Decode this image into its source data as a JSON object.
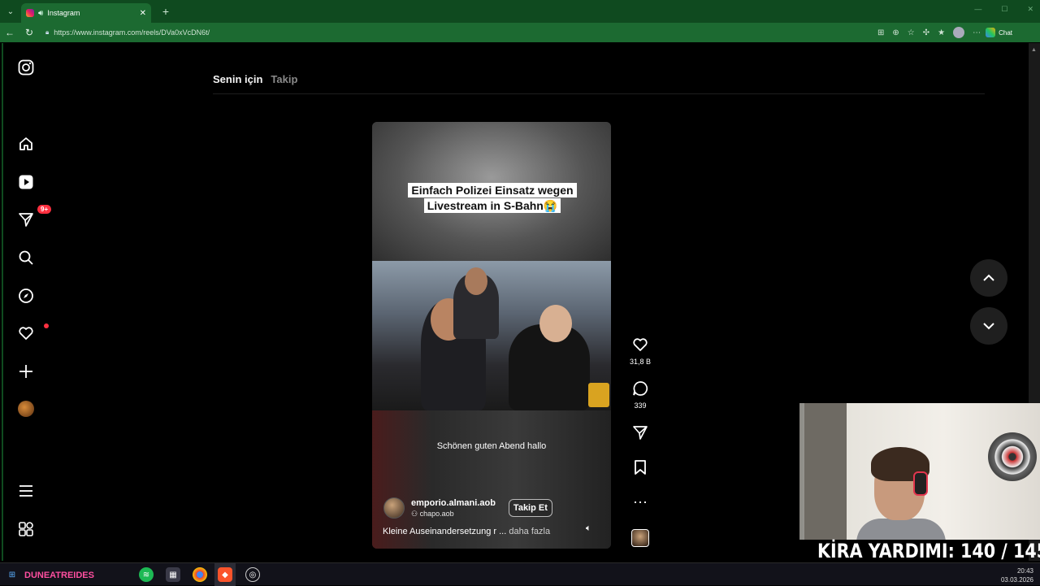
{
  "browser": {
    "tab_title": "Instagram",
    "url": "https://www.instagram.com/reels/DVa0xVcDN6t/",
    "chat_label": "Chat"
  },
  "sidebar": {
    "notifications_badge": "9+"
  },
  "feed_tabs": {
    "for_you": "Senin için",
    "following": "Takip"
  },
  "reel": {
    "overlay_line1": "Einfach Polizei Einsatz wegen",
    "overlay_line2": "Livestream in S-Bahn😭",
    "subtitle": "Schönen guten Abend hallo",
    "author": "emporio.almani.aob",
    "audio": "chapo.aob",
    "follow_label": "Takip Et",
    "description": "Kleine Auseinandersetzung r ...",
    "more_label": "daha fazla",
    "likes": "31,8 B",
    "comments": "339"
  },
  "overlay_stream": {
    "rent_counter": "KİRA YARDIMI:  140 / 145",
    "streamer_tag": "DUNEATREIDES"
  },
  "taskbar": {
    "time": "20:43",
    "date": "03.03.2026"
  },
  "colors": {
    "browser_green": "#1c6a31",
    "badge_red": "#ff3040"
  }
}
